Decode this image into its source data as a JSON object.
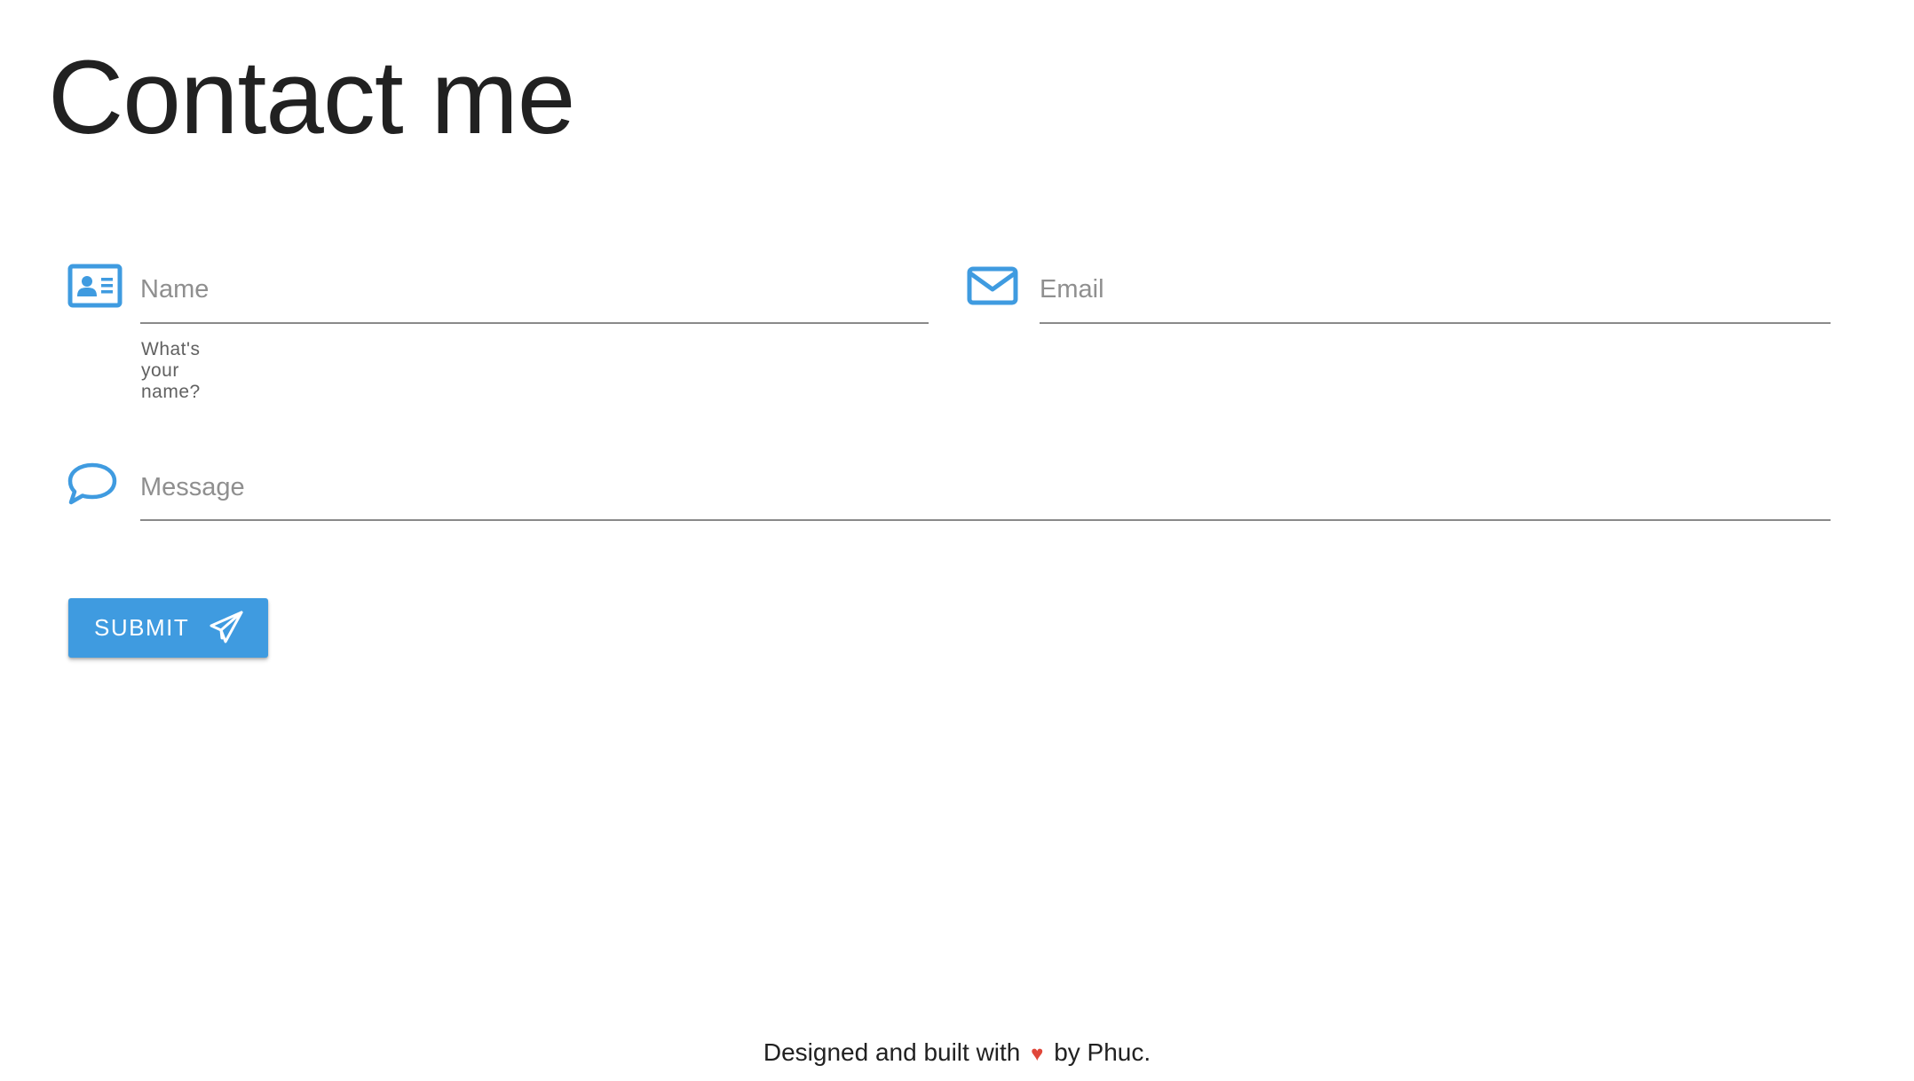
{
  "page": {
    "title": "Contact me"
  },
  "form": {
    "name": {
      "placeholder": "Name",
      "value": "",
      "hint": "What's your name?",
      "icon": "contact-card-icon"
    },
    "email": {
      "placeholder": "Email",
      "value": "",
      "icon": "envelope-icon"
    },
    "message": {
      "placeholder": "Message",
      "value": "",
      "icon": "speech-bubble-icon"
    },
    "submit": {
      "label": "SUBMIT",
      "icon": "paper-plane-icon"
    }
  },
  "footer": {
    "prefix": "Designed and built with",
    "heart": "♥",
    "suffix": "by Phuc."
  },
  "colors": {
    "accent": "#3f9be0",
    "heart": "#e0473a",
    "text": "#212121",
    "underline": "#8a8a8a"
  }
}
